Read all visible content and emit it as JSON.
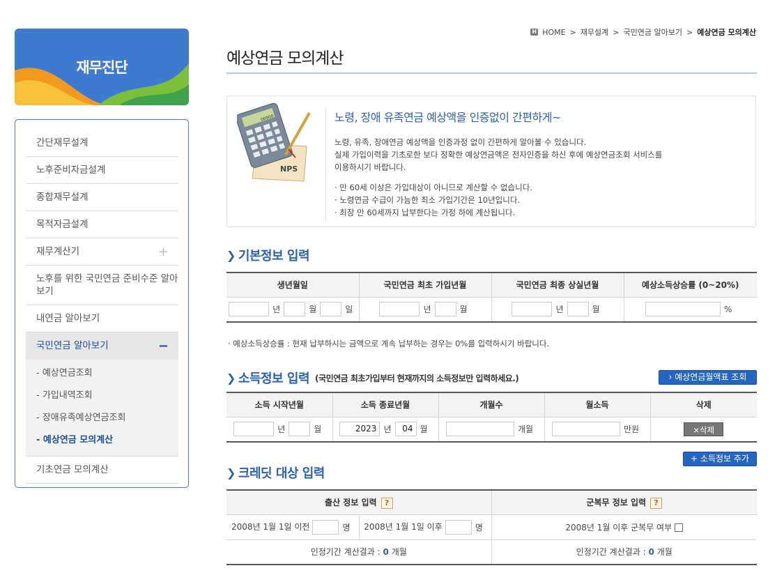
{
  "sidebar": {
    "title": "재무진단",
    "items": [
      {
        "label": "간단재무설계"
      },
      {
        "label": "노후준비자금설계"
      },
      {
        "label": "종합재무설계"
      },
      {
        "label": "목적자금설계"
      },
      {
        "label": "재무계산기",
        "toggle": "+"
      },
      {
        "label": "노후를 위한 국민연금 준비수준 알아보기"
      },
      {
        "label": "내연금 알아보기"
      },
      {
        "label": "국민연금 알아보기",
        "toggle": "−"
      },
      {
        "label": "기초연금 모의계산"
      }
    ],
    "sub_items": [
      {
        "label": "- 예상연금조회"
      },
      {
        "label": "- 가입내역조회"
      },
      {
        "label": "- 장애유족예상연금조회"
      },
      {
        "label": "- 예상연금 모의계산"
      }
    ]
  },
  "breadcrumb": {
    "home_icon": "H",
    "items": [
      "HOME",
      "재무설계",
      "국민연금 알아보기",
      "예상연금 모의계산"
    ],
    "separator": ">"
  },
  "page": {
    "title": "예상연금 모의계산"
  },
  "intro": {
    "heading": "노령, 장애 유족연금 예상액을 인증없이 간편하게~",
    "lines": [
      "노령, 유족, 장애연금 예상액을 인증과정 없이 간편하게 알아볼 수 있습니다.",
      "실제 가입이력을 기초로한 보다 정확한 예상연금액은 전자인증을 하신 후에 예상연금조회 서비스를",
      "이용하시기 바랍니다."
    ],
    "bullets": [
      "· 만 60세 이상은 가입대상이 아니므로 계산할 수 없습니다.",
      "· 노령연금 수급이 가능한 최소 가입기간은 10년입니다.",
      "· 최장 만 60세까지 납부한다는 가정 하에 계산됩니다."
    ],
    "illustration": {
      "badge": "NPS",
      "display": "00000"
    }
  },
  "basic": {
    "heading": "기본정보 입력",
    "headers": [
      "생년월일",
      "국민연금 최초 가입년월",
      "국민연금 최종 상실년월",
      "예상소득상승률 (0~20%)"
    ],
    "labels": {
      "year": "년",
      "month": "월",
      "day": "일",
      "percent": "%"
    },
    "note": "· 예상소득상승률 : 현재 납부하시는 금액으로 계속 납부하는 경우는 0%를 입력하시기 바랍니다."
  },
  "income": {
    "heading": "소득정보 입력",
    "note": "(국민연금 최초가입부터 현재까지의 소득정보만 입력하세요.)",
    "lookup_button": "› 예상연금월액표 조회",
    "headers": [
      "소득 시작년월",
      "소득 종료년월",
      "개월수",
      "월소득",
      "삭제"
    ],
    "row": {
      "start_year": "",
      "start_month": "",
      "end_year": "2023",
      "end_month": "04",
      "months": "",
      "monthly_income": ""
    },
    "labels": {
      "year": "년",
      "month": "월",
      "months_unit": "개월",
      "won_unit": "만원"
    },
    "delete_button": "×삭제",
    "add_button": "+ 소득정보 추가"
  },
  "credit": {
    "heading": "크레딧 대상 입력",
    "birth_header": "출산 정보 입력",
    "military_header": "군복무 정보 입력",
    "help_icon": "?",
    "before_label": "2008년 1월 1일 이전",
    "after_label": "2008년 1월 1일 이후",
    "person_unit": "명",
    "military_label": "2008년 1월 이후 군복무 여부",
    "result_birth_prefix": "인정기간 계산결과 :",
    "result_birth_value": "0",
    "result_military_prefix": "인정기간 계산결과 :",
    "result_military_value": "0",
    "result_unit": "개월"
  },
  "colors": {
    "accent": "#2a62b4",
    "banner": "#3d7ad0",
    "button": "#2566c0"
  }
}
